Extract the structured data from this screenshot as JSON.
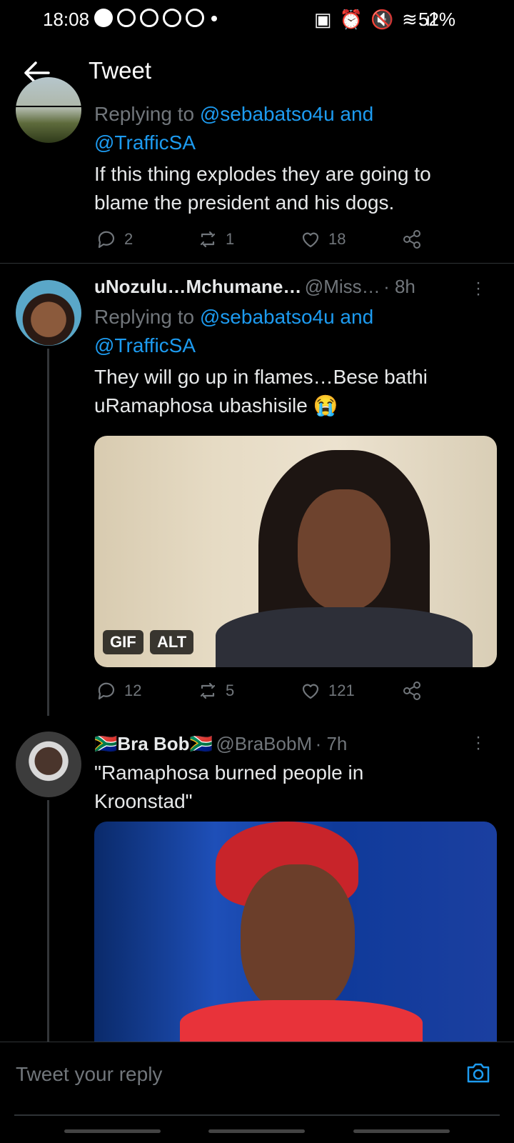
{
  "status_bar": {
    "time": "18:08",
    "right_icons": "▣ ⏰ 🔇 ≋.ıl",
    "battery": "52%"
  },
  "header": {
    "title": "Tweet"
  },
  "tweets": [
    {
      "reply_prefix": "Replying to",
      "mention1": "@sebabatso4u and",
      "mention2": "@TrafficSA",
      "text": "If this thing explodes they are going to blame the president and his dogs.",
      "replies": "2",
      "retweets": "1",
      "likes": "18"
    },
    {
      "name": "uNozulu…Mchumane…",
      "handle": "@Miss…",
      "time": "· 8h",
      "reply_prefix": "Replying to",
      "mention1": "@sebabatso4u and",
      "mention2": "@TrafficSA",
      "text_line1": "They will go up in flames…Bese bathi",
      "text_line2": "uRamaphosa ubashisile",
      "emoji": "😭",
      "media_badge_gif": "GIF",
      "media_badge_alt": "ALT",
      "replies": "12",
      "retweets": "5",
      "likes": "121"
    },
    {
      "flag": "🇿🇦",
      "name": "Bra Bob",
      "handle": "@BraBobM",
      "time": "· 7h",
      "text": "\"Ramaphosa burned people in Kroonstad\""
    }
  ],
  "composer": {
    "placeholder": "Tweet your reply"
  },
  "colors": {
    "accent": "#1d9bf0",
    "muted": "#71767b",
    "background": "#000000"
  }
}
